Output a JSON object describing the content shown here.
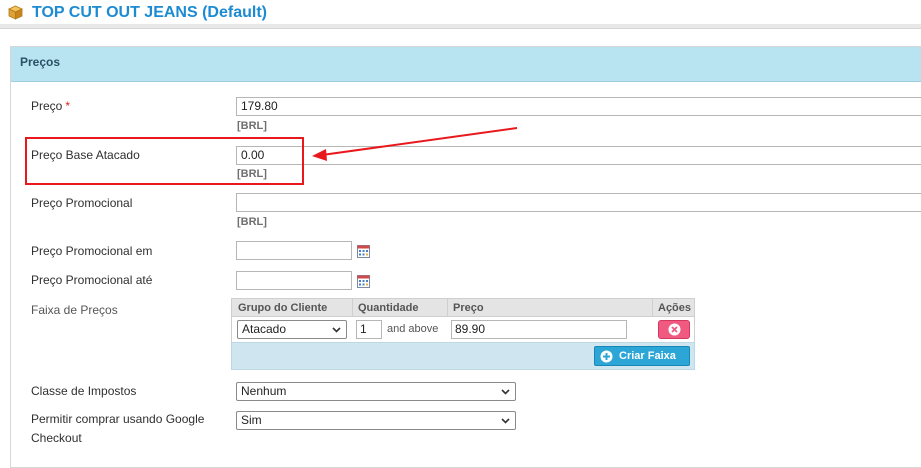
{
  "header": {
    "title": "TOP CUT OUT JEANS (Default)",
    "icon": "box-icon"
  },
  "section": {
    "title": "Preços"
  },
  "fields": {
    "price": {
      "label": "Preço",
      "required_mark": "*",
      "value": "179.80",
      "currency": "[BRL]"
    },
    "wholesale_price": {
      "label": "Preço Base Atacado",
      "value": "0.00",
      "currency": "[BRL]"
    },
    "special_price": {
      "label": "Preço Promocional",
      "value": "",
      "currency": "[BRL]"
    },
    "special_from": {
      "label": "Preço Promocional em",
      "value": ""
    },
    "special_to": {
      "label": "Preço Promocional até",
      "value": ""
    },
    "tier_price": {
      "label": "Faixa de Preços",
      "columns": [
        "Grupo do Cliente",
        "Quantidade",
        "Preço",
        "Ações"
      ],
      "rows": [
        {
          "group": "Atacado",
          "qty": "1",
          "qty_suffix": "and above",
          "price": "89.90"
        }
      ],
      "add_button": "Criar Faixa"
    },
    "tax_class": {
      "label": "Classe de Impostos",
      "value": "Nenhum"
    },
    "google_checkout": {
      "label_line1": "Permitir comprar usando Google",
      "label_line2": "Checkout",
      "value": "Sim"
    }
  },
  "colors": {
    "accent": "#1c8bd2",
    "section_header": "#b8e3f0",
    "annotation": "#e8181c",
    "delete": "#f15a80",
    "add": "#2ba6d6"
  }
}
